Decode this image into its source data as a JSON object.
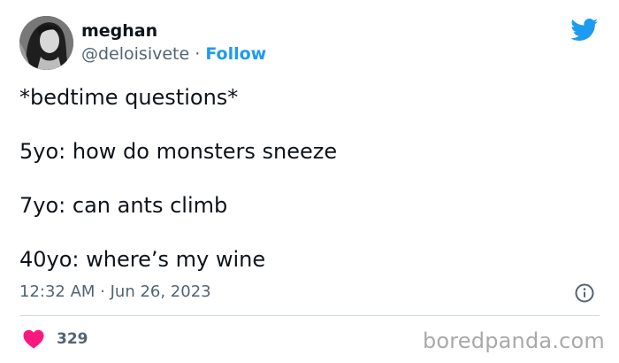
{
  "user": {
    "display_name": "meghan",
    "handle": "@deloisivete",
    "separator": " · ",
    "follow_label": "Follow",
    "avatar_icon": "profile-photo"
  },
  "tweet": {
    "lines": [
      "*bedtime questions*",
      "5yo: how do monsters sneeze",
      "7yo: can ants climb",
      "40yo: where’s my wine"
    ],
    "timestamp": "12:32 AM · Jun 26, 2023"
  },
  "actions": {
    "like_count": "329",
    "like_icon": "heart-icon",
    "info_icon": "info-icon"
  },
  "brand": {
    "logo_icon": "twitter-bird-icon",
    "watermark": "boredpanda.com"
  },
  "colors": {
    "text": "#0f1419",
    "secondary": "#536471",
    "accent": "#1d9bf0",
    "like": "#f91880",
    "divider": "#cfd9de",
    "watermark": "#a9a9a9"
  }
}
